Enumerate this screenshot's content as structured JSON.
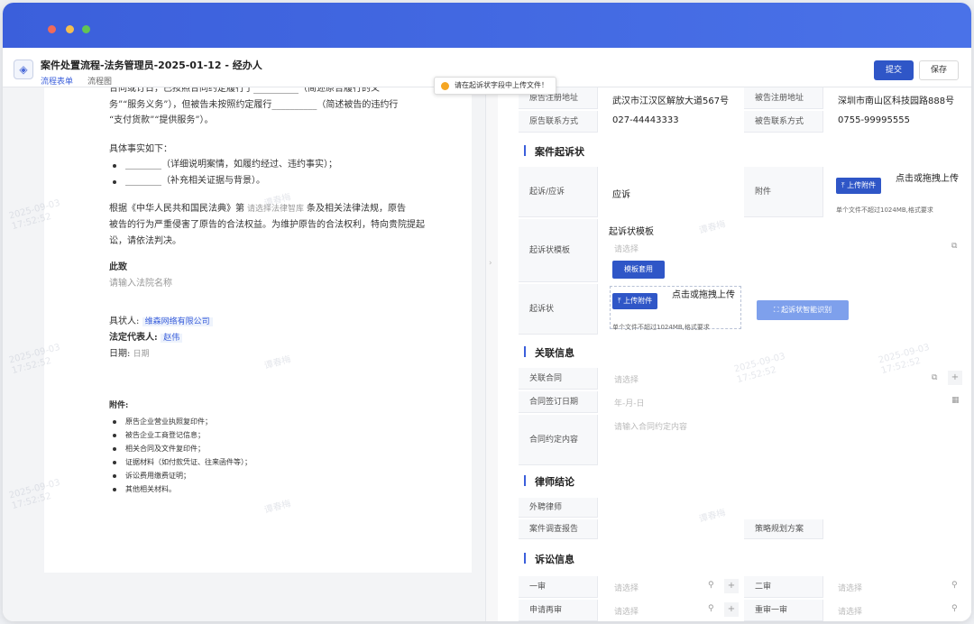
{
  "header": {
    "title": "案件处置流程-法务管理员-2025-01-12 - 经办人",
    "tabs": [
      "流程表单",
      "流程图"
    ],
    "submit": "提交",
    "save": "保存"
  },
  "toast": "请在起诉状字段中上传文件！",
  "watermark": {
    "name": "谭春梅",
    "date": "2025-09-03",
    "time": "17:52:52"
  },
  "document": {
    "line1": "合同或订日，已按照合同约定履行了__________（简述原告履行的义",
    "line2": "务”“服务义务”），但被告未按照约定履行__________（简述被告的违约行",
    "line3": "“支付货款”“提供服务”）。",
    "facts_title": "具体事实如下：",
    "fact1": "________（详细说明案情，如履约经过、违约事实）；",
    "fact2": "________（补充相关证据与背景）。",
    "law_a": "根据《中华人民共和国民法典》第",
    "law_ph": "请选择法律智库",
    "law_b": "条及相关法律法规，原告",
    "law2": "被告的行为严重侵害了原告的合法权益。为维护原告的合法权利，特向贵院提起",
    "law3": "讼，请依法判决。",
    "to": "此致",
    "court_ph": "请输入法院名称",
    "plaintiff_label": "具状人:",
    "plaintiff": "维森网络有限公司",
    "rep_label": "法定代表人:",
    "rep": "赵伟",
    "date_label": "日期:",
    "date_ph": "日期",
    "attach_title": "附件:",
    "attachments": [
      "原告企业营业执照复印件；",
      "被告企业工商登记信息；",
      "相关合同及文件复印件；",
      "证据材料（如付款凭证、往来函件等）；",
      "诉讼费用缴费证明；",
      "其他相关材料。"
    ]
  },
  "form": {
    "reg_addr_plaintiff_label": "原告注册地址",
    "reg_addr_plaintiff": "武汉市江汉区解放大道567号",
    "reg_addr_defendant_label": "被告注册地址",
    "reg_addr_defendant": "深圳市南山区科技园路888号",
    "phone_plaintiff_label": "原告联系方式",
    "phone_plaintiff": "027-44443333",
    "phone_defendant_label": "被告联系方式",
    "phone_defendant": "0755-99995555",
    "sec_complaint": "案件起诉状",
    "sue_label": "起诉/应诉",
    "sue_value": "应诉",
    "attach_label": "附件",
    "upload_btn": "上传附件",
    "upload_hint": "点击或拖拽上传",
    "size_hint_a": "单个文件不超过1024MB,格式要求",
    "size_hint_b": "单个文件不超过1024MB,格式要求",
    "template_label": "起诉状模板",
    "template_title": "起诉状模板",
    "select_ph": "请选择",
    "template_apply": "模板套用",
    "complaint_label": "起诉状",
    "smart_btn": "起诉状智能识别",
    "sec_related": "关联信息",
    "related_contract": "关联合同",
    "sign_date": "合同签订日期",
    "date_ph": "年-月-日",
    "contract_content": "合同约定内容",
    "contract_ph": "请输入合同约定内容",
    "sec_lawyer": "律师结论",
    "ext_lawyer": "外聘律师",
    "investigation": "案件调查报告",
    "strategy": "策略规划方案",
    "sec_lit": "诉讼信息",
    "first": "一审",
    "second": "二审",
    "retrial_apply": "申请再审",
    "retrial": "重审一审"
  }
}
